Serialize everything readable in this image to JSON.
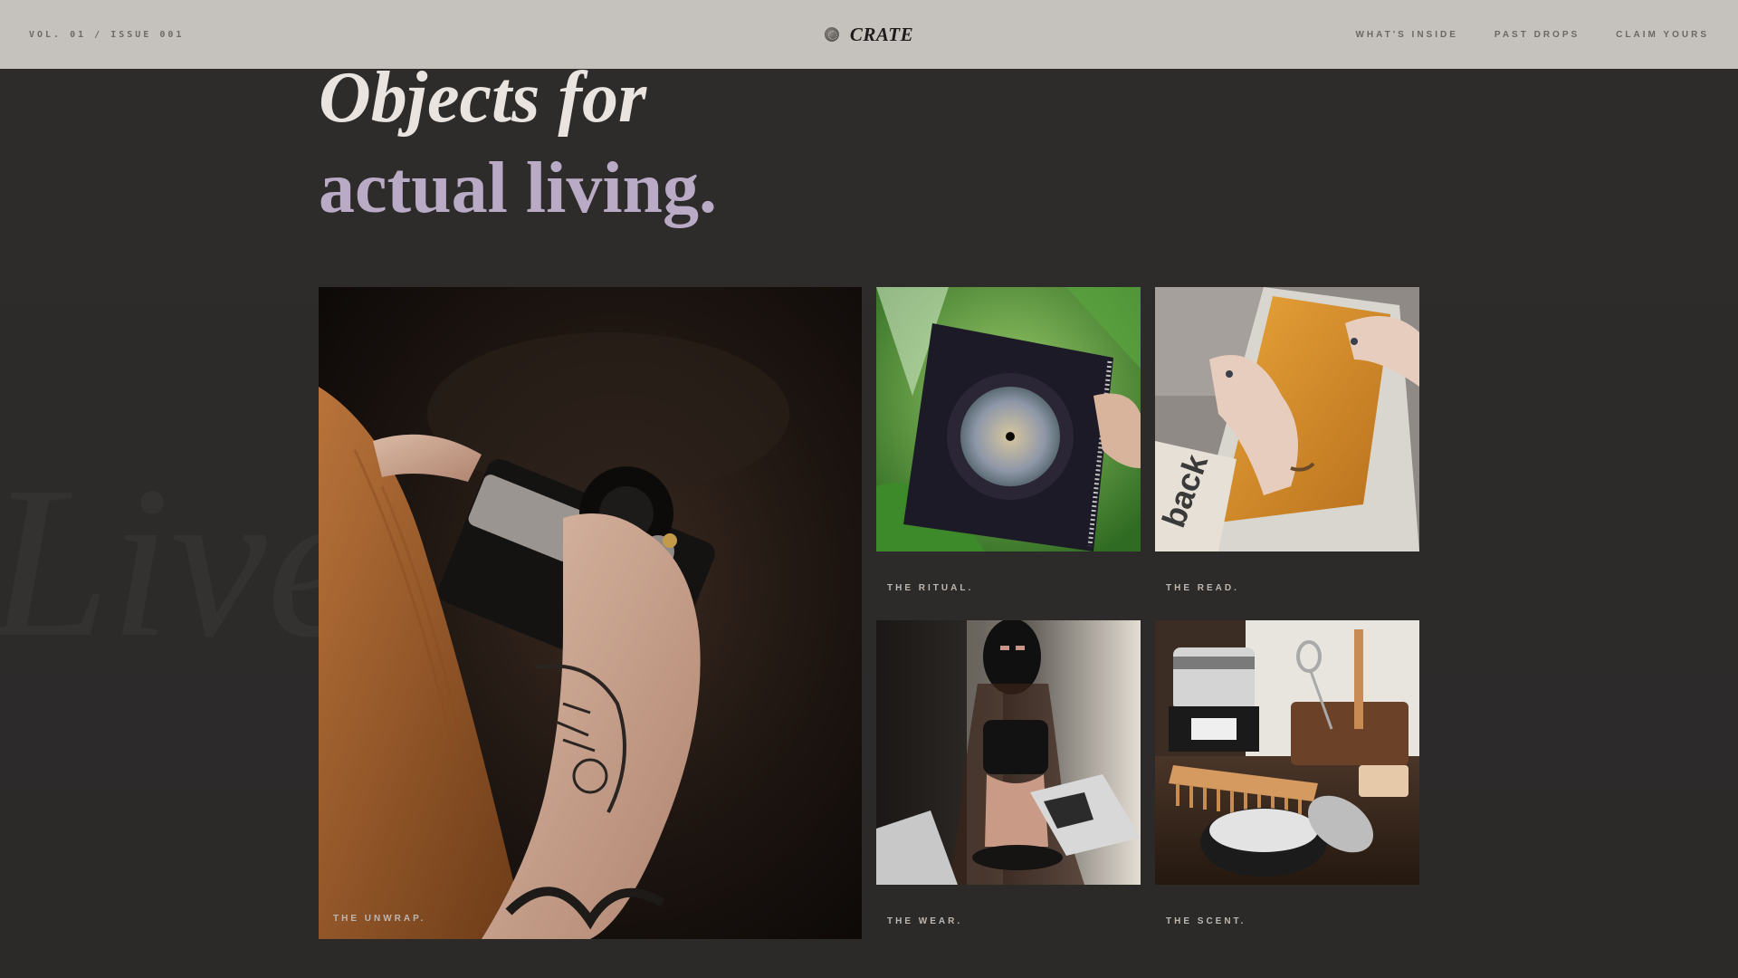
{
  "header": {
    "issue_label": "VOL. 01 / ISSUE 001",
    "brand_name": "CRATE",
    "nav": [
      {
        "label": "WHAT'S INSIDE"
      },
      {
        "label": "PAST DROPS"
      },
      {
        "label": "CLAIM YOURS"
      }
    ]
  },
  "hero": {
    "line1": "Objects for",
    "line2": "actual living.",
    "watermark": "Live"
  },
  "grid": {
    "large": {
      "caption": "THE UNWRAP."
    },
    "items": [
      {
        "caption": "THE RITUAL."
      },
      {
        "caption": "THE READ."
      },
      {
        "caption": "THE WEAR."
      },
      {
        "caption": "THE SCENT."
      }
    ]
  },
  "colors": {
    "background": "#2d2b2a",
    "topbar": "#c5c1bd",
    "headline_primary": "#e9e4df",
    "headline_accent": "#b9aac6"
  },
  "icons": {
    "brand": "crate-logo-icon"
  }
}
